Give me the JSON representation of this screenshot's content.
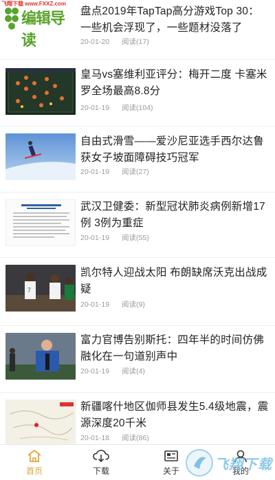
{
  "watermark_top": "飞翔下载 www.FXXZ.com",
  "watermark_logo": "飞翔下载",
  "articles": [
    {
      "title": "盘点2019年TapTap高分游戏Top 30：一些机会浮现了，一些题材没落了",
      "date": "20-01-20",
      "views": "阅读(17)",
      "thumb_text": "编辑导读"
    },
    {
      "title": "皇马vs塞维利亚评分：梅开二度 卡塞米罗全场最高8.8分",
      "date": "20-01-19",
      "views": "阅读(104)"
    },
    {
      "title": "自由式滑雪——爱沙尼亚选手西尔达鲁获女子坡面障碍技巧冠军",
      "date": "20-01-19",
      "views": "阅读(27)"
    },
    {
      "title": "武汉卫健委：新型冠状肺炎病例新增17例 3例为重症",
      "date": "20-01-19",
      "views": "阅读(55)"
    },
    {
      "title": "凯尔特人迎战太阳 布朗缺席沃克出战成疑",
      "date": "20-01-19",
      "views": "阅读(9)"
    },
    {
      "title": "富力官博告别斯托：四年半的时间仿佛融化在一句道别声中",
      "date": "20-01-19",
      "views": "阅读(4)"
    },
    {
      "title": "新疆喀什地区伽师县发生5.4级地震，震源深度20千米",
      "date": "20-01-18",
      "views": "阅读(86)"
    }
  ],
  "tabs": [
    {
      "label": "首页",
      "icon": "home-icon",
      "active": true
    },
    {
      "label": "下载",
      "icon": "cloud-download-icon",
      "active": false
    },
    {
      "label": "关于",
      "icon": "news-card-icon",
      "active": false
    },
    {
      "label": "我的",
      "icon": "user-icon",
      "active": false
    }
  ],
  "colors": {
    "active": "#e0a53a",
    "logo_green": "#5aa32c",
    "text": "#222222",
    "meta": "#9a9a9a"
  }
}
